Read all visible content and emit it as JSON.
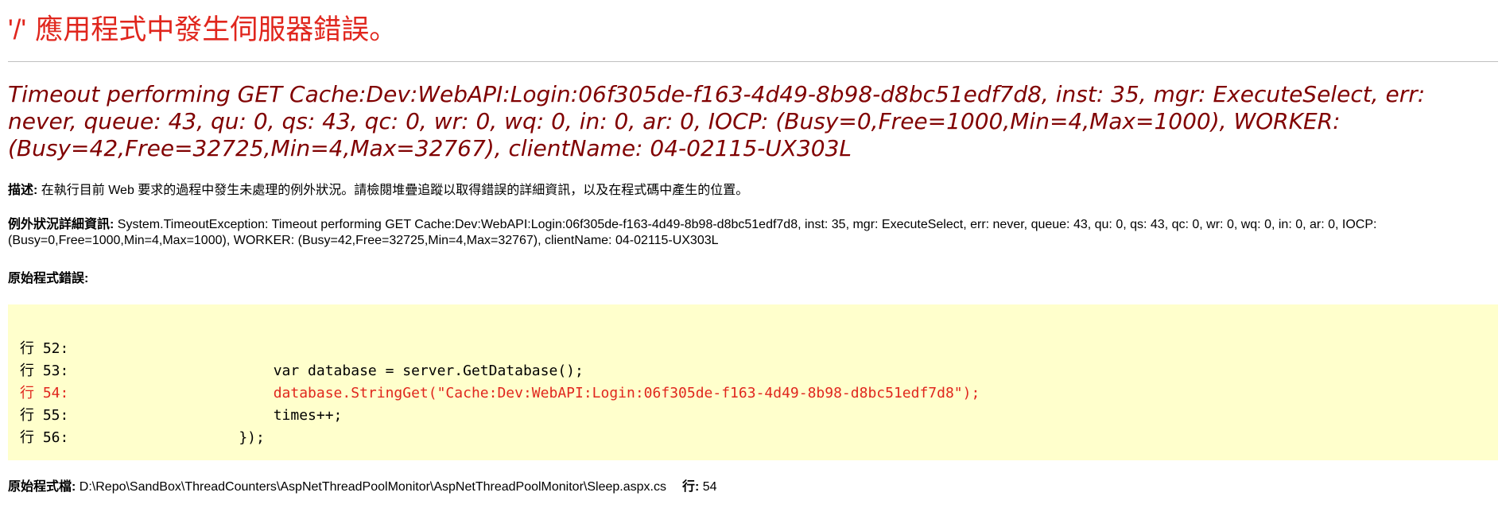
{
  "title": {
    "quote": "'/'",
    "text": " 應用程式中發生伺服器錯誤。"
  },
  "exception_message": "Timeout performing GET Cache:Dev:WebAPI:Login:06f305de-f163-4d49-8b98-d8bc51edf7d8, inst: 35, mgr: ExecuteSelect, err: never, queue: 43, qu: 0, qs: 43, qc: 0, wr: 0, wq: 0, in: 0, ar: 0, IOCP: (Busy=0,Free=1000,Min=4,Max=1000), WORKER: (Busy=42,Free=32725,Min=4,Max=32767), clientName: 04-02115-UX303L",
  "description": {
    "label": "描述:",
    "text": " 在執行目前 Web 要求的過程中發生未處理的例外狀況。請檢閱堆疊追蹤以取得錯誤的詳細資訊，以及在程式碼中產生的位置。"
  },
  "exception_details": {
    "label": "例外狀況詳細資訊:",
    "text": " System.TimeoutException: Timeout performing GET Cache:Dev:WebAPI:Login:06f305de-f163-4d49-8b98-d8bc51edf7d8, inst: 35, mgr: ExecuteSelect, err: never, queue: 43, qu: 0, qs: 43, qc: 0, wr: 0, wq: 0, in: 0, ar: 0, IOCP: (Busy=0,Free=1000,Min=4,Max=1000), WORKER: (Busy=42,Free=32725,Min=4,Max=32767), clientName: 04-02115-UX303L"
  },
  "source_error": {
    "label": "原始程式錯誤:",
    "lines": [
      {
        "number": "行 52:",
        "code": ""
      },
      {
        "number": "行 53:",
        "code": "        var database = server.GetDatabase();"
      },
      {
        "number": "行 54:",
        "code": "        database.StringGet(\"Cache:Dev:WebAPI:Login:06f305de-f163-4d49-8b98-d8bc51edf7d8\");"
      },
      {
        "number": "行 55:",
        "code": "        times++;"
      },
      {
        "number": "行 56:",
        "code": "    });"
      }
    ],
    "highlight_color": "#e0261d"
  },
  "source_file": {
    "label": "原始程式檔:",
    "path": " D:\\Repo\\SandBox\\ThreadCounters\\AspNetThreadPoolMonitor\\AspNetThreadPoolMonitor\\Sleep.aspx.cs",
    "line_label": "行:",
    "line_value": " 54"
  },
  "colors": {
    "title": "#e0261d",
    "exception_heading": "#800000",
    "code_background": "#ffffcc"
  }
}
